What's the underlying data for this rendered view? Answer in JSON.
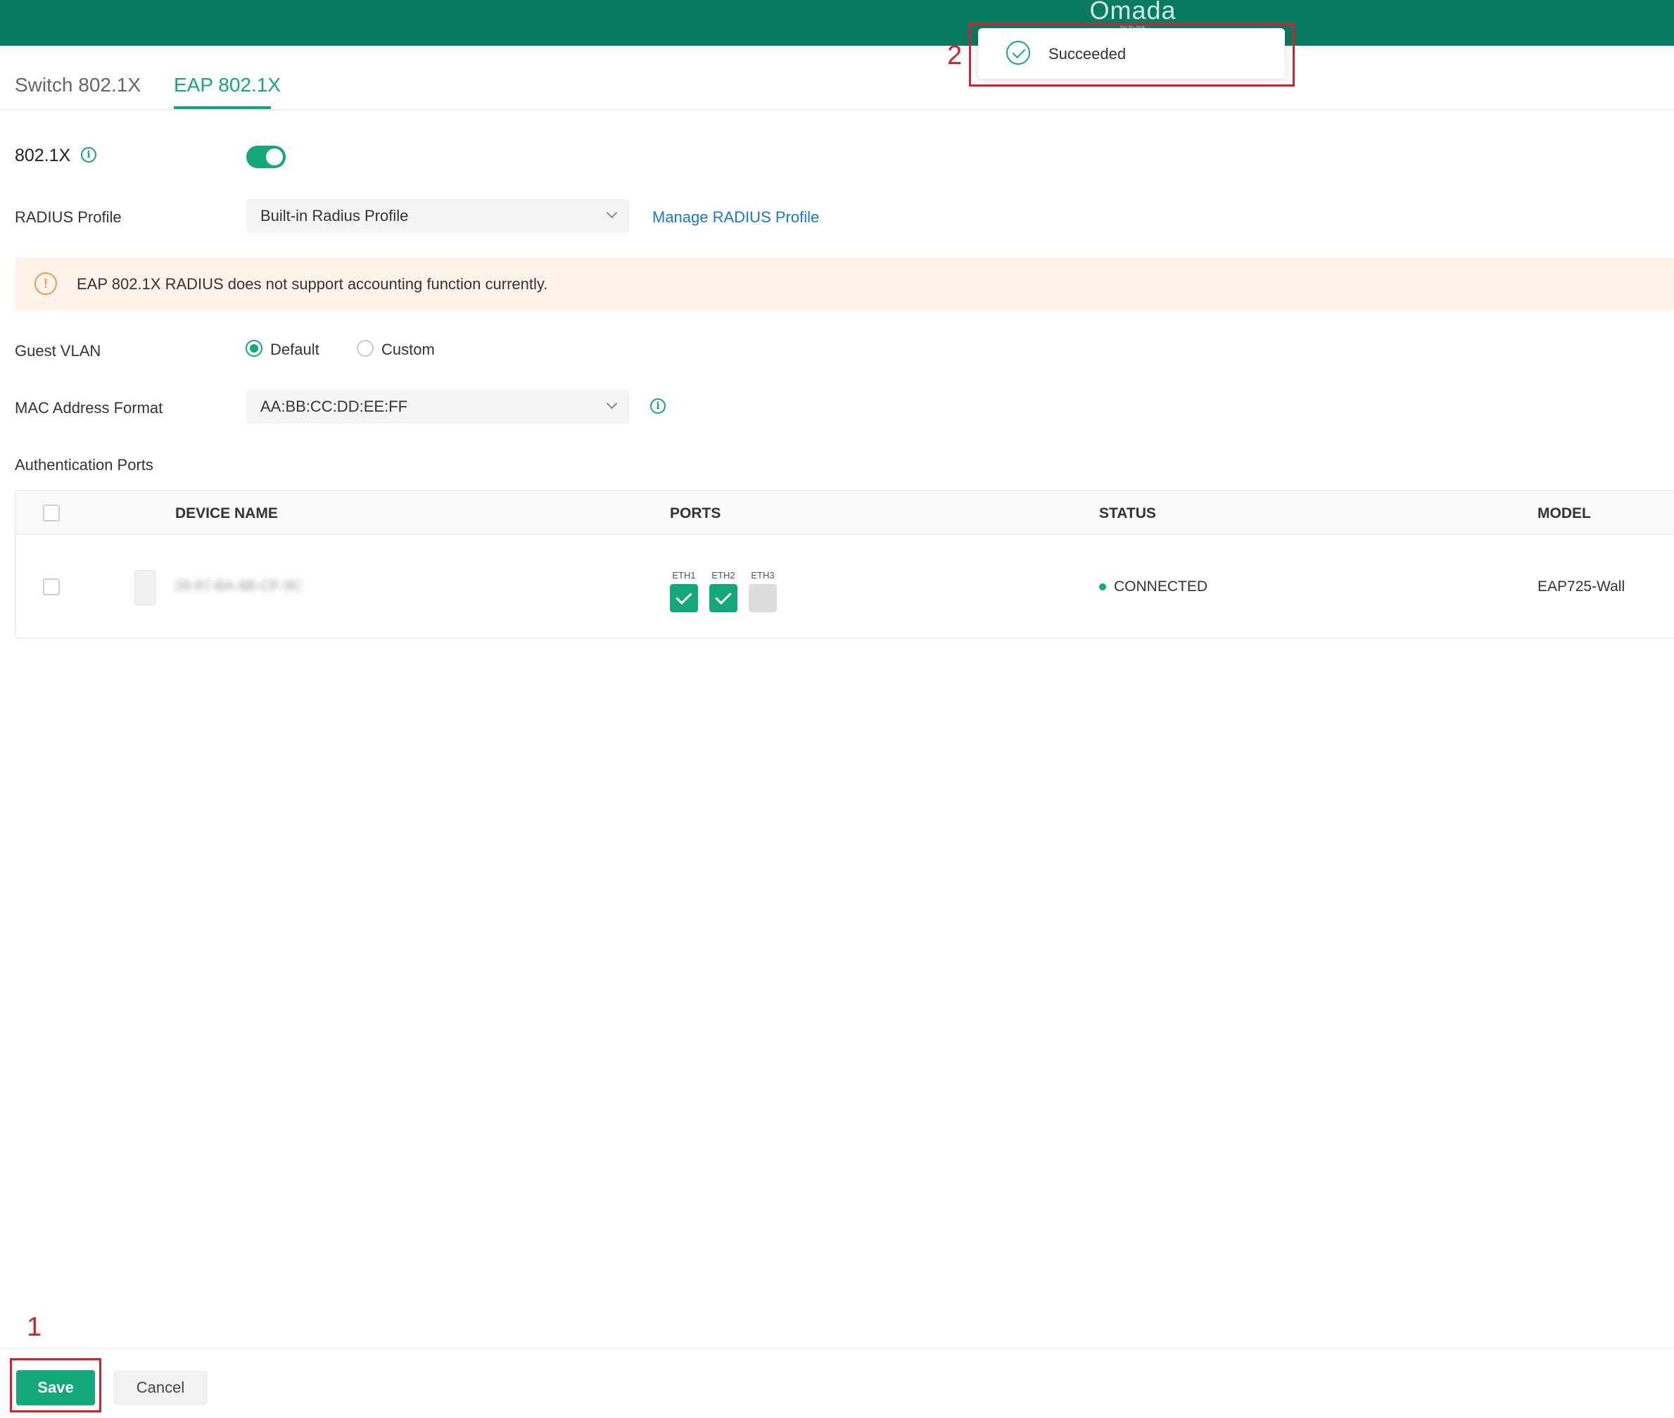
{
  "header": {
    "brand": "Omada",
    "brand_sub": "by tp-link"
  },
  "tabs": [
    {
      "label": "Switch 802.1X"
    },
    {
      "label": "EAP 802.1X"
    }
  ],
  "form": {
    "dot1x_label": "802.1X",
    "dot1x_enabled": true,
    "radius_label": "RADIUS Profile",
    "radius_value": "Built-in Radius Profile",
    "manage_link": "Manage RADIUS Profile",
    "alert_text": "EAP 802.1X RADIUS does not support accounting function currently.",
    "guest_vlan_label": "Guest VLAN",
    "guest_vlan_options": [
      "Default",
      "Custom"
    ],
    "guest_vlan_selected": "Default",
    "mac_format_label": "MAC Address Format",
    "mac_format_value": "AA:BB:CC:DD:EE:FF",
    "auth_ports_label": "Authentication Ports"
  },
  "table": {
    "columns": [
      "DEVICE NAME",
      "PORTS",
      "STATUS",
      "MODEL"
    ],
    "rows": [
      {
        "device_name": "28-87-BA-8B-CF-9C",
        "ports": [
          {
            "label": "ETH1",
            "checked": true
          },
          {
            "label": "ETH2",
            "checked": true
          },
          {
            "label": "ETH3",
            "checked": false
          }
        ],
        "status": "CONNECTED",
        "model": "EAP725-Wall"
      }
    ]
  },
  "footer": {
    "save_label": "Save",
    "cancel_label": "Cancel"
  },
  "toast": {
    "text": "Succeeded"
  },
  "annotations": {
    "step1": "1",
    "step2": "2"
  },
  "colors": {
    "brand_green": "#0a7a63",
    "accent": "#15a77c",
    "link": "#1976d2",
    "warning": "#f29a4a",
    "annotation": "#d61f2c"
  }
}
